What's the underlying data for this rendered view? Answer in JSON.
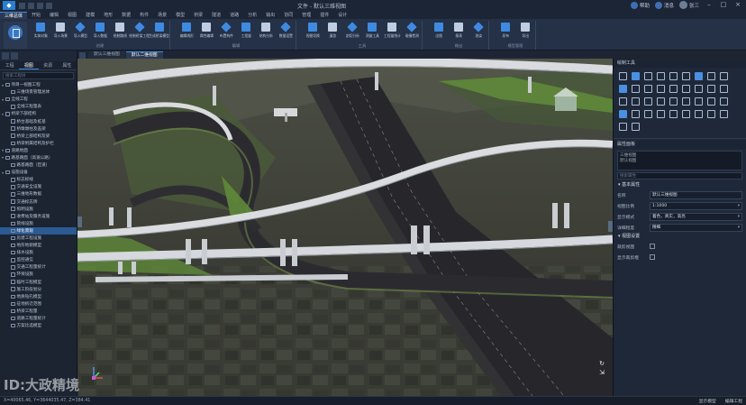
{
  "window": {
    "title": "文件 - 默认三维视图",
    "user": "张三",
    "help": "帮助",
    "message": "消息"
  },
  "ribbon_tabs": [
    "三维总体",
    "开始",
    "编辑",
    "视图",
    "建模",
    "地形",
    "数据",
    "构件",
    "场景",
    "模型",
    "桥梁",
    "隧道",
    "道路",
    "分析",
    "输出",
    "协同",
    "管理",
    "插件",
    "设计"
  ],
  "active_tab_index": 0,
  "ribbon": {
    "groups": [
      {
        "name": "创建",
        "buttons": [
          "实体对象",
          "导入场景",
          "导入模型",
          "导入数据",
          "绘制路线",
          "绘制桥梁工程",
          "生成桥梁模型"
        ]
      },
      {
        "name": "编辑",
        "buttons": [
          "编辑线形",
          "属性编辑",
          "布置构件",
          "工程量",
          "结构分析",
          "数据设置"
        ]
      },
      {
        "name": "工具",
        "buttons": [
          "视图切换",
          "漫游",
          "剖切分析",
          "测量工具",
          "工程量统计",
          "碰撞检测"
        ]
      },
      {
        "name": "输出",
        "buttons": [
          "出图",
          "报表",
          "渲染"
        ]
      },
      {
        "name": "模型管理",
        "buttons": [
          "发布",
          "导出"
        ]
      }
    ]
  },
  "left_panel": {
    "tabs": [
      "工程",
      "视图",
      "资源",
      "属性"
    ],
    "active_tab_index": 1,
    "search_placeholder": "搜索工程树",
    "tree": [
      {
        "label": "项目一视图工程",
        "level": 0,
        "checked": true
      },
      {
        "label": "三维场景管理总体",
        "level": 1,
        "checked": true
      },
      {
        "label": "全线工程",
        "level": 0,
        "checked": true
      },
      {
        "label": "全线工程量表",
        "level": 1,
        "checked": true
      },
      {
        "label": "桥梁下部结构",
        "level": 0,
        "checked": true
      },
      {
        "label": "桥台基础及桩基",
        "level": 1,
        "checked": true
      },
      {
        "label": "桥墩墩柱及盖梁",
        "level": 1,
        "checked": true
      },
      {
        "label": "桥梁上部结构及梁",
        "level": 1,
        "checked": true
      },
      {
        "label": "桥梁附属结构及护栏",
        "level": 1,
        "checked": true
      },
      {
        "label": "道路地面",
        "level": 0,
        "checked": true
      },
      {
        "label": "路基路面（高速公路）",
        "level": 0,
        "checked": true
      },
      {
        "label": "路基路面（匝道）",
        "level": 1,
        "checked": true
      },
      {
        "label": "设施设备",
        "level": 0,
        "checked": true
      },
      {
        "label": "标志标线",
        "level": 1,
        "checked": true
      },
      {
        "label": "交通安全设施",
        "level": 1,
        "checked": true
      },
      {
        "label": "三维地形数据",
        "level": 1,
        "checked": true
      },
      {
        "label": "交通标志牌",
        "level": 1,
        "checked": true
      },
      {
        "label": "照明设施",
        "level": 1,
        "checked": true
      },
      {
        "label": "收费站及服务设施",
        "level": 1,
        "checked": true
      },
      {
        "label": "管线设施",
        "level": 1,
        "checked": true
      },
      {
        "label": "绿化景观",
        "level": 1,
        "checked": true,
        "selected": true
      },
      {
        "label": "房建工程设施",
        "level": 1,
        "checked": true
      },
      {
        "label": "地形地貌模型",
        "level": 1,
        "checked": true
      },
      {
        "label": "排水设施",
        "level": 1,
        "checked": true
      },
      {
        "label": "监控通信",
        "level": 1,
        "checked": true
      },
      {
        "label": "交通工程量统计",
        "level": 1,
        "checked": true
      },
      {
        "label": "环保设施",
        "level": 1,
        "checked": true
      },
      {
        "label": "临时工程模型",
        "level": 1,
        "checked": true
      },
      {
        "label": "施工阶段划分",
        "level": 1,
        "checked": true
      },
      {
        "label": "地质钻孔模型",
        "level": 1,
        "checked": true
      },
      {
        "label": "征地拆迁范围",
        "level": 1,
        "checked": true
      },
      {
        "label": "桥梁工程量",
        "level": 1,
        "checked": true
      },
      {
        "label": "道路工程量统计",
        "level": 1,
        "checked": true
      },
      {
        "label": "方案比选模型",
        "level": 1,
        "checked": true
      }
    ]
  },
  "viewport": {
    "tabs": [
      "默认三维视图",
      "默认二维视图"
    ],
    "active_tab_index": 1
  },
  "right_panel": {
    "tools_title": "绘制工具",
    "props_title": "属性面板",
    "box_lines": [
      "三维视图",
      "默认视图"
    ],
    "search_placeholder": "搜索属性",
    "section_basic": "基本属性",
    "section_extra": "视图设置",
    "props": [
      {
        "key": "名称",
        "value": "默认三维视图"
      },
      {
        "key": "视图比例",
        "value": "1:1000"
      },
      {
        "key": "显示模式",
        "value": "着色，真实，高亮"
      },
      {
        "key": "详细程度",
        "value": "精细"
      }
    ],
    "checks": [
      {
        "key": "裁剪视图",
        "checked": false
      },
      {
        "key": "显示裁剪框",
        "checked": false
      }
    ]
  },
  "status": {
    "coords": "X=40065.46, Y=3644035.47, Z=384.41",
    "btn1": "显示模型",
    "btn2": "编辑工程"
  },
  "watermark": "ID:大政精境",
  "colors": {
    "accent": "#3f8ae0",
    "panel_bg": "#1f2838",
    "selected_row": "#2c5a93"
  }
}
